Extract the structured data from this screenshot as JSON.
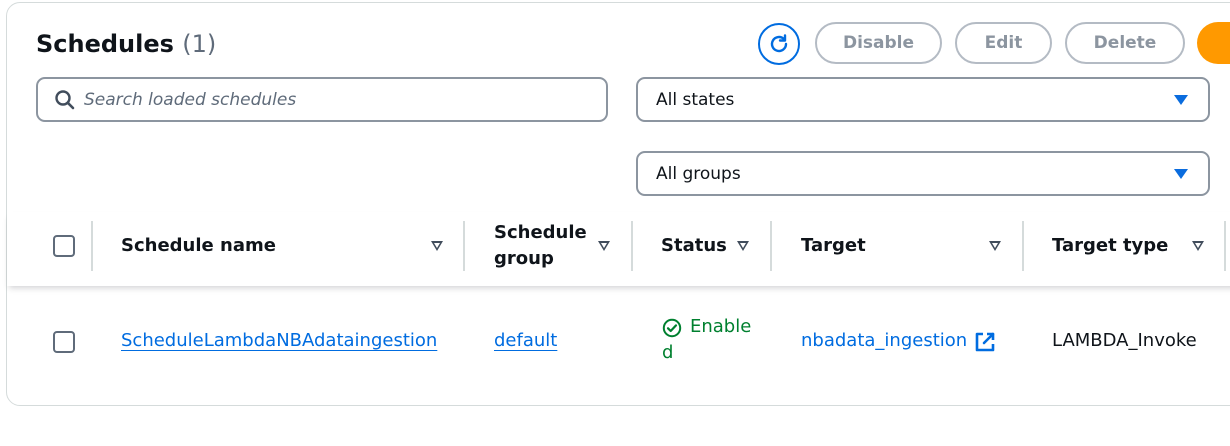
{
  "header": {
    "title": "Schedules",
    "count": "(1)"
  },
  "actions": {
    "refresh_icon": "refresh-icon",
    "disable_label": "Disable",
    "edit_label": "Edit",
    "delete_label": "Delete",
    "primary_color": "#ff9900"
  },
  "filters": {
    "search_placeholder": "Search loaded schedules",
    "state_selected": "All states",
    "group_selected": "All groups"
  },
  "table": {
    "columns": [
      "Schedule name",
      "Schedule group",
      "Status",
      "Target",
      "Target type"
    ],
    "rows": [
      {
        "name": "ScheduleLambdaNBAdataingestion",
        "group": "default",
        "status": "Enabled",
        "target": "nbadata_ingestion",
        "target_type": "LAMBDA_Invoke"
      }
    ]
  },
  "colors": {
    "link": "#006ce0",
    "status_enabled": "#00802f"
  }
}
